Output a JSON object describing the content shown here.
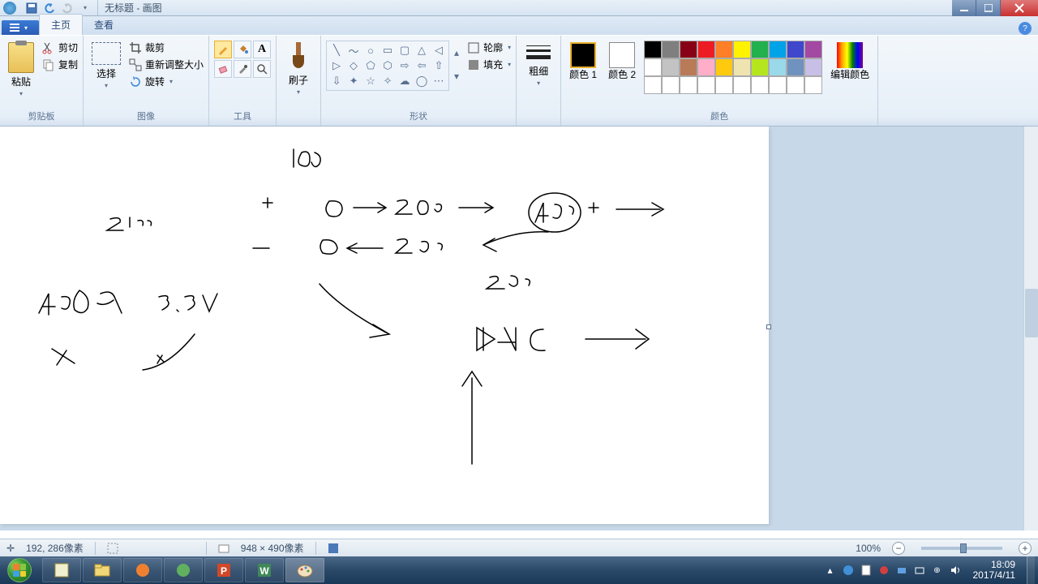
{
  "title": "无标题 - 画图",
  "tabs": {
    "file": "",
    "home": "主页",
    "view": "查看"
  },
  "groups": {
    "clipboard": "剪贴板",
    "image": "图像",
    "tools": "工具",
    "shapes": "形状",
    "colors": "颜色"
  },
  "clipboard": {
    "paste": "粘贴",
    "cut": "剪切",
    "copy": "复制"
  },
  "image": {
    "select": "选择",
    "crop": "裁剪",
    "resize": "重新调整大小",
    "rotate": "旋转"
  },
  "brush": "刷子",
  "shape_opts": {
    "outline": "轮廓",
    "fill": "填充"
  },
  "lineweight": "粗细",
  "color1_label": "颜色 1",
  "color2_label": "颜色 2",
  "edit_colors": "编辑颜色",
  "palette_row1": [
    "#000000",
    "#7f7f7f",
    "#880015",
    "#ed1c24",
    "#ff7f27",
    "#fff200",
    "#22b14c",
    "#00a2e8",
    "#3f48cc",
    "#a349a4"
  ],
  "palette_row2": [
    "#ffffff",
    "#c3c3c3",
    "#b97a57",
    "#ffaec9",
    "#ffc90e",
    "#efe4b0",
    "#b5e61d",
    "#99d9ea",
    "#7092be",
    "#c8bfe7"
  ],
  "status": {
    "cursor": "192, 286像素",
    "selection": "",
    "canvas_size": "948 × 490像素",
    "zoom": "100%"
  },
  "taskbar": {
    "time": "18:09",
    "date": "2017/4/11"
  }
}
